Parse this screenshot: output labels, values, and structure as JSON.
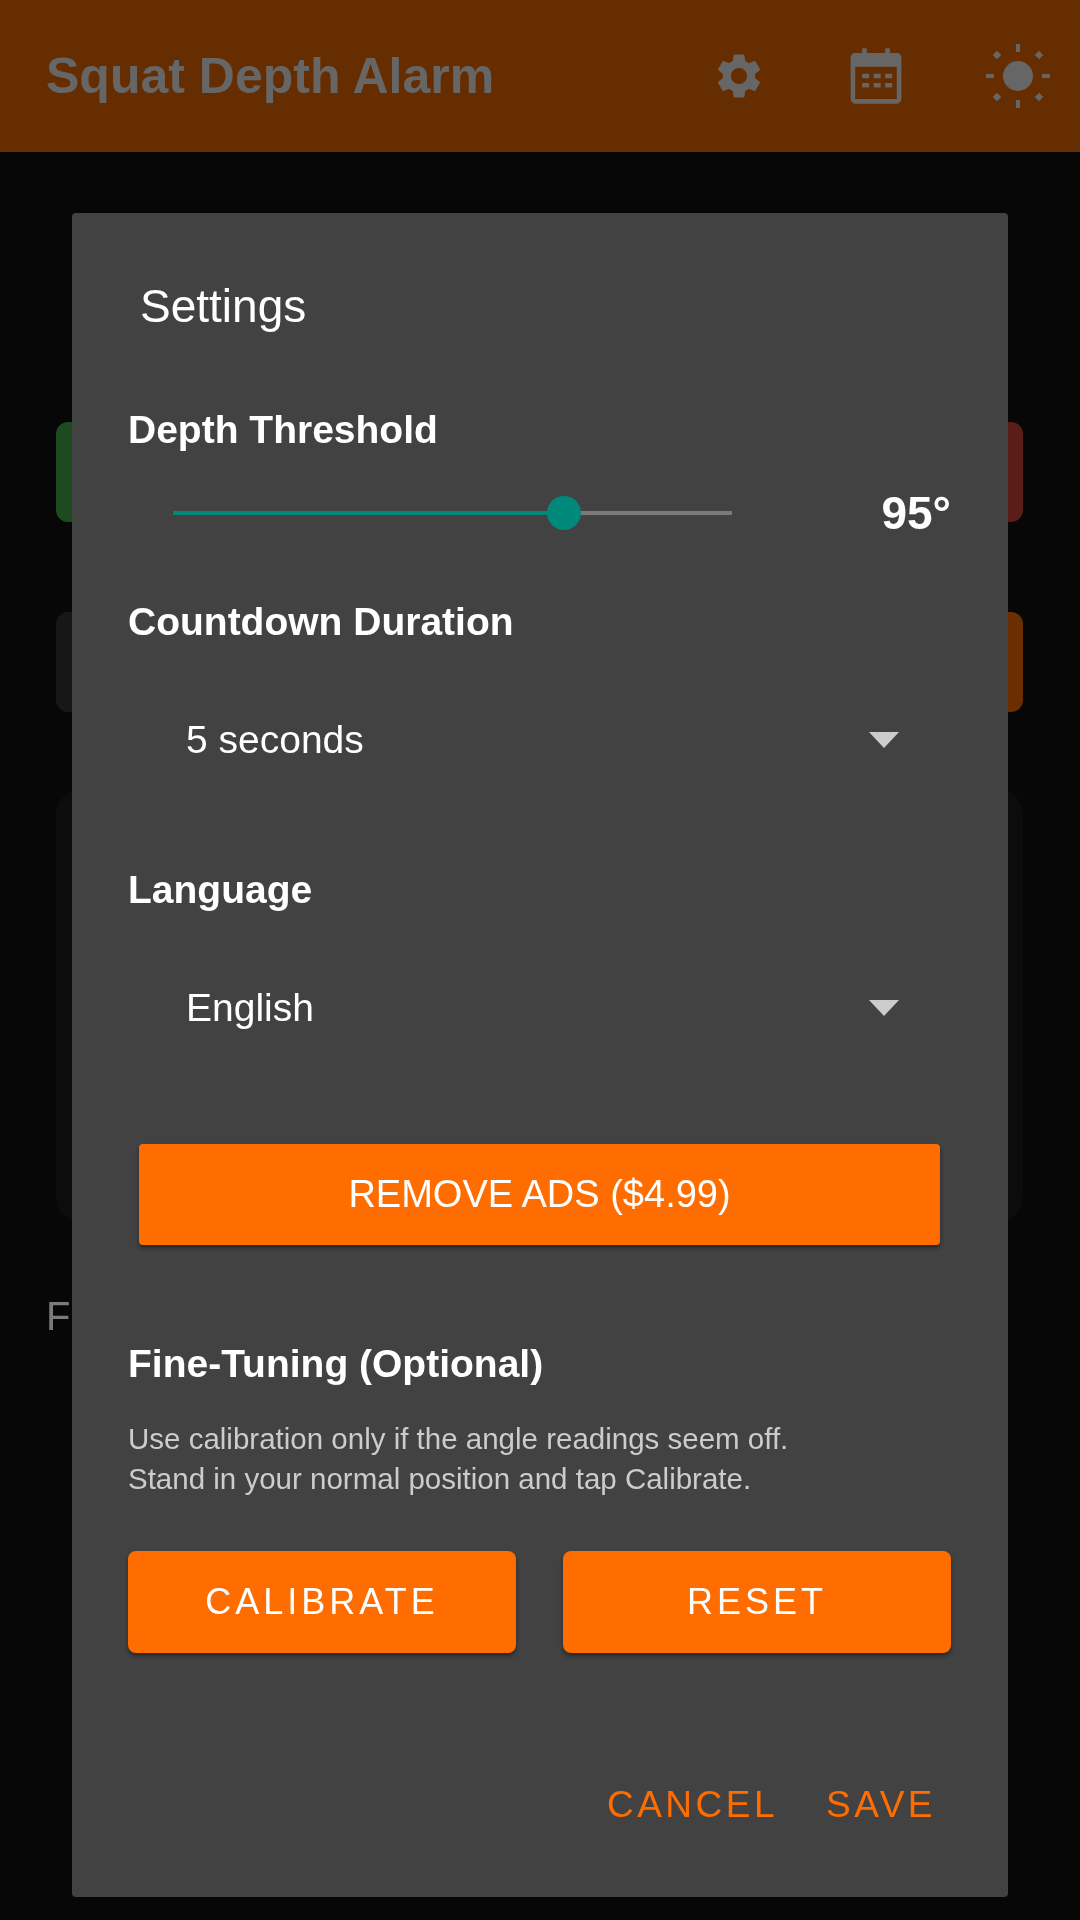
{
  "app_bar": {
    "title": "Squat Depth Alarm"
  },
  "background": {
    "partial_text": "F"
  },
  "dialog": {
    "title": "Settings",
    "depth_threshold": {
      "label": "Depth Threshold",
      "level": 0.7,
      "reading": "95°"
    },
    "countdown": {
      "label": "Countdown Duration",
      "value": "5 seconds"
    },
    "language": {
      "label": "Language",
      "value": "English"
    },
    "remove_ads_button": "REMOVE ADS ($4.99)",
    "fine_tuning": {
      "heading": "Fine-Tuning (Optional)",
      "help": "Use calibration only if the angle readings seem off.\nStand in your normal position and tap Calibrate.",
      "buttons": [
        "CALIBRATE",
        "RESET"
      ]
    },
    "actions": [
      "CANCEL",
      "SAVE"
    ]
  }
}
